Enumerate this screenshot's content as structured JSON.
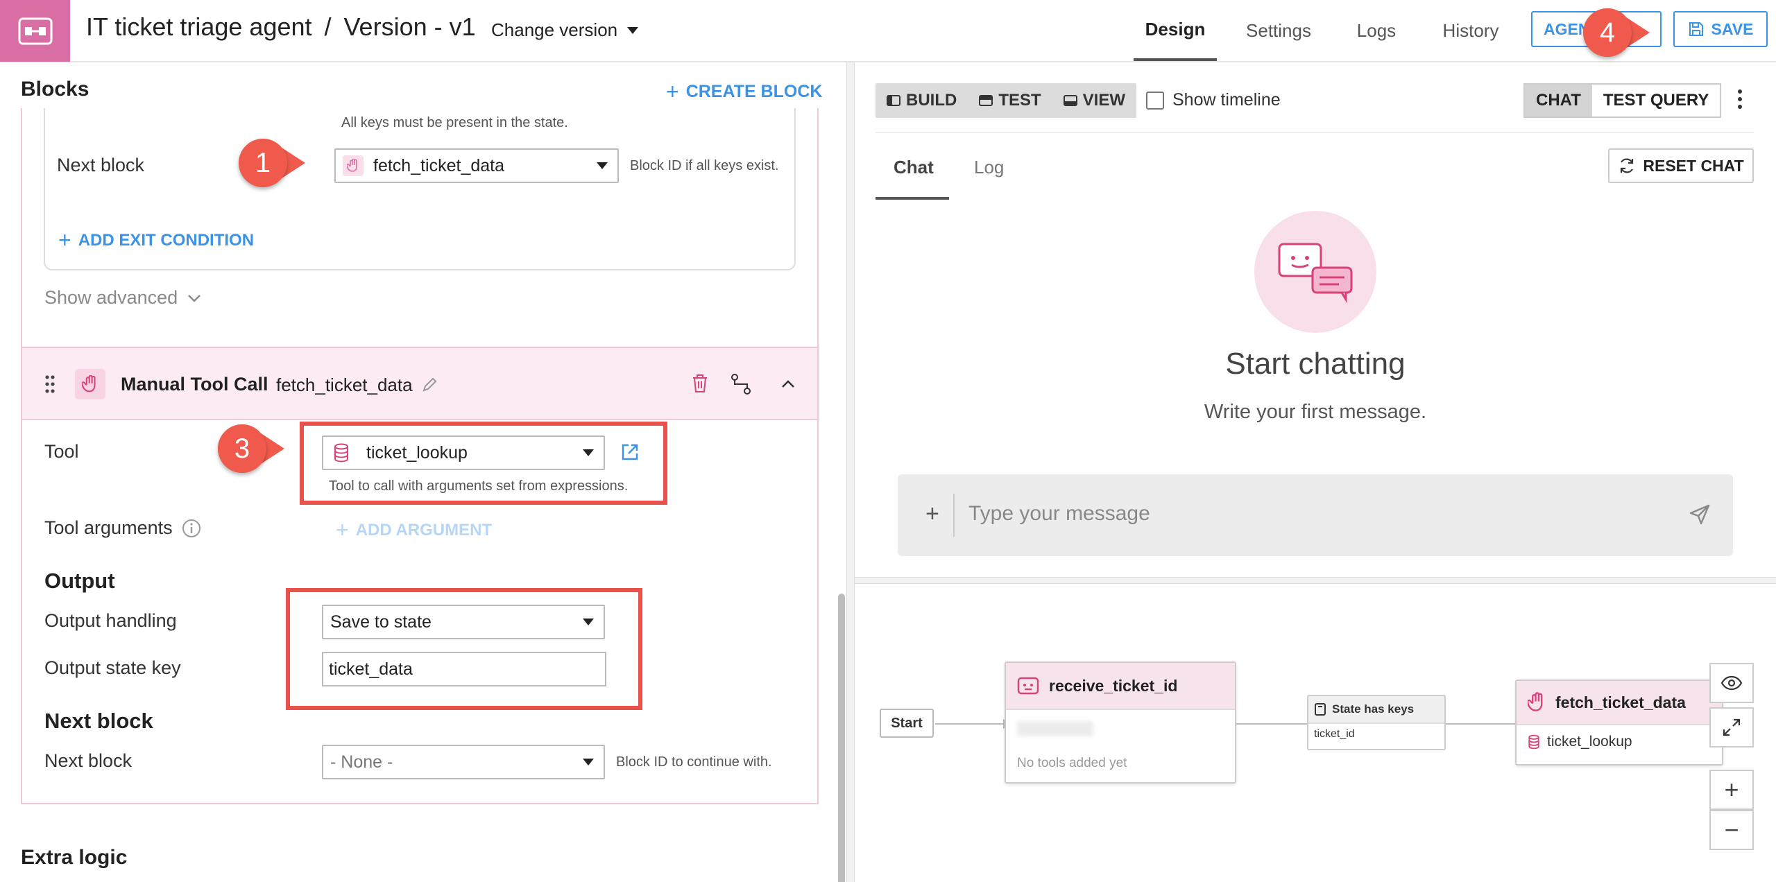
{
  "topbar": {
    "project": "IT ticket triage agent",
    "separator": "/",
    "version": "Version - v1",
    "change_version": "Change version",
    "nav": [
      "Design",
      "Settings",
      "Logs",
      "History"
    ],
    "agent_button": "AGENT",
    "save_button": "SAVE"
  },
  "left": {
    "title": "Blocks",
    "create_block": "CREATE BLOCK",
    "exit_hint": "All keys must be present in the state.",
    "next_block_label": "Next block",
    "next_block_value": "fetch_ticket_data",
    "next_block_hint": "Block ID if all keys exist.",
    "add_exit_condition": "ADD EXIT CONDITION",
    "show_advanced": "Show advanced",
    "block": {
      "type": "Manual Tool Call",
      "id": "fetch_ticket_data",
      "tool_label": "Tool",
      "tool_value": "ticket_lookup",
      "tool_hint": "Tool to call with arguments set from expressions.",
      "tool_args_label": "Tool arguments",
      "add_argument": "ADD ARGUMENT",
      "output_title": "Output",
      "output_handling_label": "Output handling",
      "output_handling_value": "Save to state",
      "output_key_label": "Output state key",
      "output_key_value": "ticket_data",
      "next_title": "Next block",
      "next_label": "Next block",
      "next_value": "- None -",
      "next_hint": "Block ID to continue with."
    },
    "extra_logic": "Extra logic"
  },
  "right": {
    "modes": [
      "BUILD",
      "TEST",
      "VIEW"
    ],
    "show_timeline": "Show timeline",
    "toggle": [
      "CHAT",
      "TEST QUERY"
    ],
    "tabs": [
      "Chat",
      "Log"
    ],
    "reset_chat": "RESET CHAT",
    "start_title": "Start chatting",
    "start_sub": "Write your first message.",
    "message_placeholder": "Type your message",
    "flow": {
      "start": "Start",
      "node1_title": "receive_ticket_id",
      "node1_empty": "No tools added yet",
      "cond_title": "State has keys",
      "cond_value": "ticket_id",
      "node2_title": "fetch_ticket_data",
      "node2_tool": "ticket_lookup"
    }
  },
  "annotations": [
    "1",
    "3",
    "4"
  ],
  "colors": {
    "accent": "#3a93e6",
    "brand": "#d96ea5",
    "highlight": "#e8524a",
    "badge": "#ef5a4c"
  }
}
